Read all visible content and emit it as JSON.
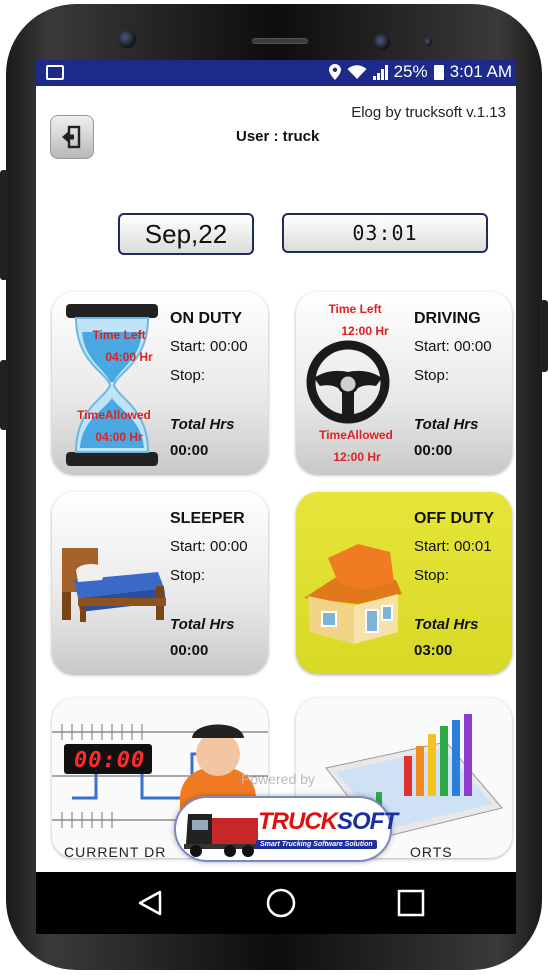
{
  "status_bar": {
    "battery": "25%",
    "time": "3:01 AM"
  },
  "header": {
    "app_title": "Elog by trucksoft v.1.13",
    "user": "User : truck"
  },
  "date_display": "Sep,22",
  "time_display": "03:01",
  "cards": [
    {
      "id": "on-duty",
      "title": "ON DUTY",
      "start": "Start: 00:00",
      "stop": "Stop:",
      "total_label": "Total Hrs",
      "total_value": "00:00",
      "time_left_label": "Time Left",
      "time_left_value": "04:00 Hr",
      "time_allowed_label": "TimeAllowed",
      "time_allowed_value": "04:00 Hr"
    },
    {
      "id": "driving",
      "title": "DRIVING",
      "start": "Start: 00:00",
      "stop": "Stop:",
      "total_label": "Total Hrs",
      "total_value": "00:00",
      "time_left_label": "Time Left",
      "time_left_value": "12:00 Hr",
      "time_allowed_label": "TimeAllowed",
      "time_allowed_value": "12:00 Hr"
    },
    {
      "id": "sleeper",
      "title": "SLEEPER",
      "start": "Start: 00:00",
      "stop": "Stop:",
      "total_label": "Total Hrs",
      "total_value": "00:00"
    },
    {
      "id": "off-duty",
      "title": "OFF DUTY",
      "start": "Start: 00:01",
      "stop": "Stop:",
      "total_label": "Total Hrs",
      "total_value": "03:00",
      "active_color": "#e2e230"
    }
  ],
  "bottom_tiles": {
    "clock_digits": "00:00",
    "left_caption": "CURRENT DR",
    "right_caption": "ORTS"
  },
  "footer": {
    "powered_by": "Powered by",
    "logo_text_1": "TRUCK",
    "logo_text_2": "SOFT",
    "logo_tagline": "Smart Trucking Software Solution"
  },
  "colors": {
    "status_bar": "#1e2a8a",
    "accent_red": "#e02020",
    "off_duty_bg": "#e2e230"
  }
}
